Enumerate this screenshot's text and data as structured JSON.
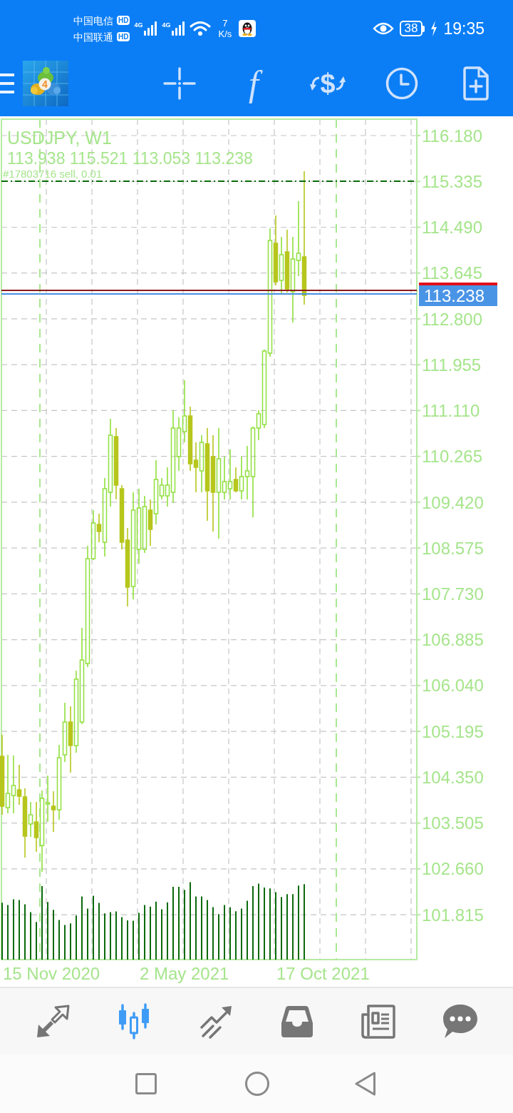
{
  "status_bar": {
    "carriers": [
      {
        "name": "中国电信",
        "badge": "HD"
      },
      {
        "name": "中国联通",
        "badge": "HD"
      }
    ],
    "networks": [
      {
        "label": "4G"
      },
      {
        "label": "4G"
      }
    ],
    "speed": {
      "value": "7",
      "unit": "K/s"
    },
    "battery": "38",
    "charging": true,
    "time": "19:35"
  },
  "toolbar": {
    "logo_badge": "4",
    "indicators_label": "f",
    "trade_label": "$"
  },
  "chart": {
    "title": "USDJPY, W1",
    "ohlc": "113.938 115.521 113.053 113.238",
    "order_label": "#17803716 sell, 0.01",
    "price_labels": [
      "116.180",
      "115.335",
      "114.490",
      "113.645",
      "112.800",
      "111.955",
      "111.110",
      "110.265",
      "109.420",
      "108.575",
      "107.730",
      "106.885",
      "106.040",
      "105.195",
      "104.350",
      "103.505",
      "102.660",
      "101.815"
    ],
    "current_price": "113.238",
    "time_labels": [
      "15 Nov 2020",
      "2 May 2021",
      "17 Oct 2021"
    ]
  },
  "bottom_nav": {
    "tabs": [
      {
        "kind": "quotes",
        "selected": false
      },
      {
        "kind": "chart",
        "selected": true
      },
      {
        "kind": "trade",
        "selected": false
      },
      {
        "kind": "history",
        "selected": false
      },
      {
        "kind": "news",
        "selected": false
      },
      {
        "kind": "chat",
        "selected": false
      }
    ]
  }
}
